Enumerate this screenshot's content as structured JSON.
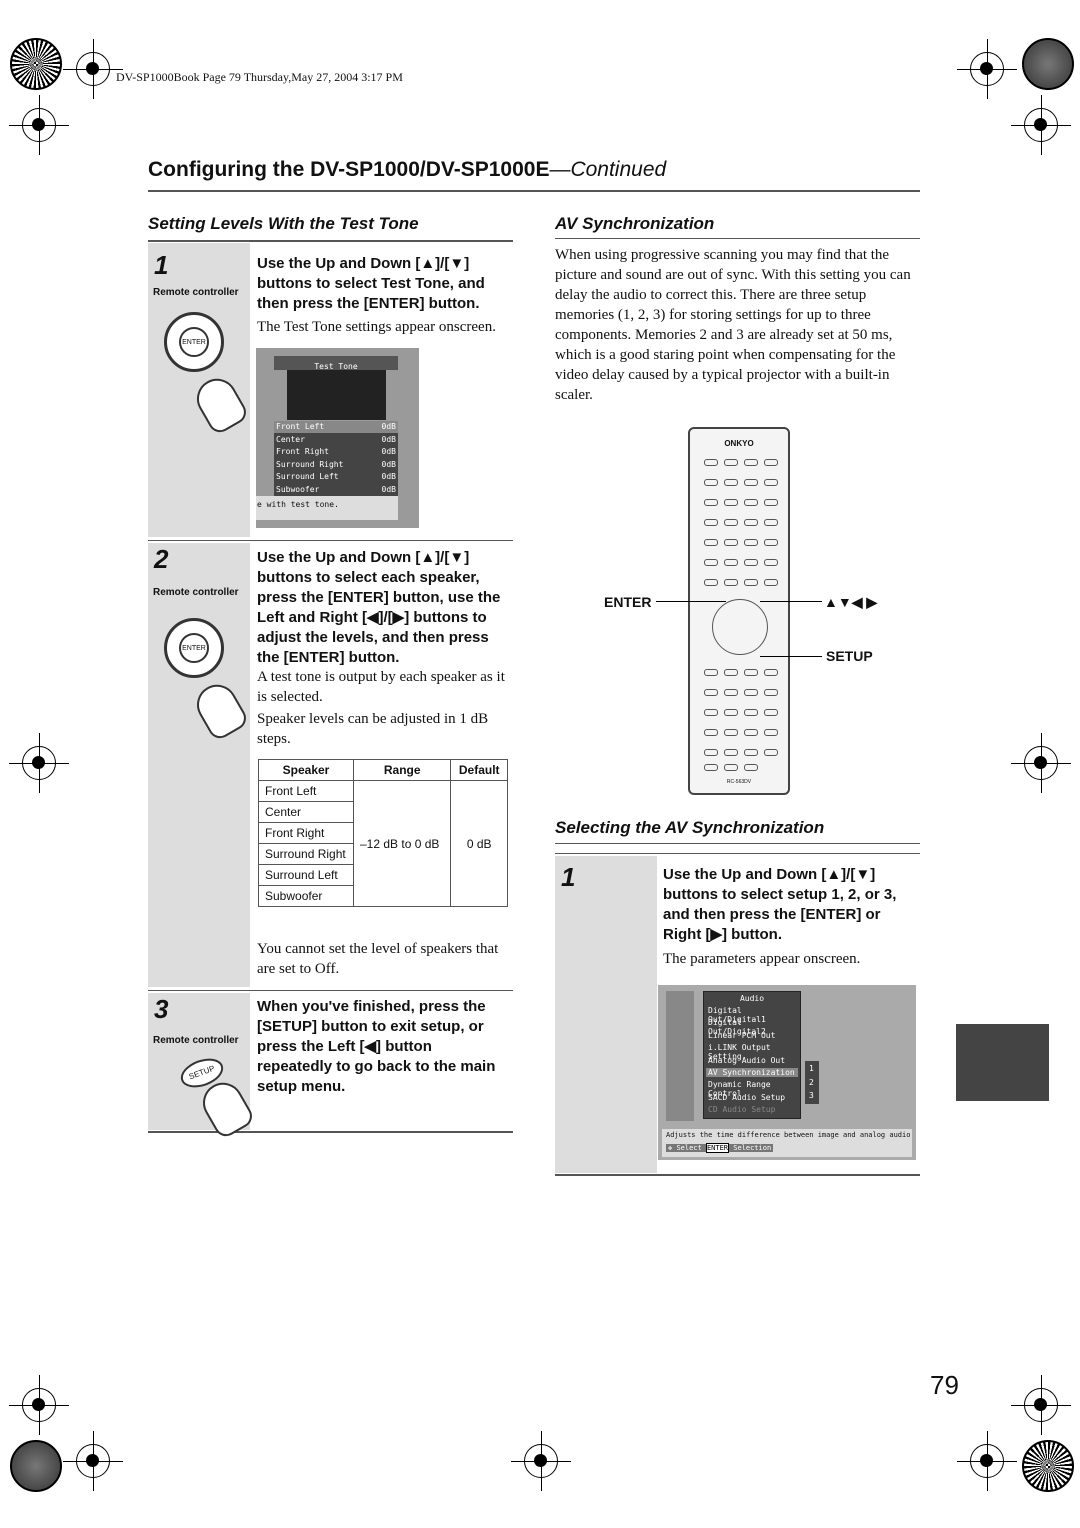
{
  "header": {
    "file_line": "DV-SP1000Book  Page 79  Thursday,May 27, 2004  3:17 PM"
  },
  "title": {
    "main": "Configuring the DV-SP1000/DV-SP1000E",
    "suffix": "—Continued"
  },
  "left": {
    "heading": "Setting Levels With the Test Tone",
    "remote_label": "Remote controller",
    "enter_label": "ENTER",
    "setup_label": "SETUP",
    "steps": [
      {
        "num": "1",
        "instruction": "Use the Up and Down [▲]/[▼] buttons to select Test Tone, and then press the [ENTER] button.",
        "body": [
          "The Test Tone settings appear onscreen."
        ]
      },
      {
        "num": "2",
        "instruction": "Use the Up and Down [▲]/[▼] buttons to select each speaker, press the [ENTER] button, use the Left and Right [◀]/[▶] buttons to adjust the levels, and then press the [ENTER] button.",
        "body": [
          "A test tone is output by each speaker as it is selected.",
          "Speaker levels can be adjusted in 1 dB steps."
        ],
        "note": "You cannot set the level of speakers that are set to Off."
      },
      {
        "num": "3",
        "instruction": "When you've finished, press the [SETUP] button to exit setup, or press the Left [◀] button repeatedly to go back to the main setup menu."
      }
    ],
    "osd": {
      "title": "Test Tone",
      "rows": [
        [
          "Front Left",
          "0dB"
        ],
        [
          "Center",
          "0dB"
        ],
        [
          "Front Right",
          "0dB"
        ],
        [
          "Surround Right",
          "0dB"
        ],
        [
          "Surround Left",
          "0dB"
        ],
        [
          "Subwoofer",
          "0dB"
        ]
      ],
      "footer": "e with test tone."
    },
    "table": {
      "headers": [
        "Speaker",
        "Range",
        "Default"
      ],
      "speakers": [
        "Front Left",
        "Center",
        "Front Right",
        "Surround Right",
        "Surround Left",
        "Subwoofer"
      ],
      "range": "–12 dB to 0 dB",
      "default": "0 dB"
    }
  },
  "right": {
    "heading": "AV Synchronization",
    "intro": "When using progressive scanning you may find that the picture and sound are out of sync. With this setting you can delay the audio to correct this. There are three setup memories (1, 2, 3) for storing settings for up to three components. Memories 2 and 3 are already set at 50 ms, which is a good staring point when compensating for the video delay caused by a typical projector with a built-in scaler.",
    "remote": {
      "brand": "ONKYO",
      "model": "RC-563DV"
    },
    "callouts": {
      "enter": "ENTER",
      "arrows": "▲▼◀ ▶",
      "setup": "SETUP"
    },
    "heading2": "Selecting the AV Synchronization",
    "step": {
      "num": "1",
      "instruction": "Use the Up and Down [▲]/[▼] buttons to select setup 1, 2, or 3, and then press the [ENTER] or Right [▶] button.",
      "body": "The parameters appear onscreen."
    },
    "osd": {
      "title": "Audio",
      "items": [
        "Digital Out/Digital1",
        "Digital Out/Digital2",
        "Linear PCM Out",
        "i.LINK Output Setting",
        "Analog Audio Out",
        "AV Synchronization",
        "Dynamic Range Control",
        "SACD Audio Setup",
        "CD Audio Setup"
      ],
      "selected": "AV Synchronization",
      "memories": [
        "1",
        "2",
        "3"
      ],
      "help": "Adjusts the time difference between image and analog audio",
      "select": "Select",
      "enter": "ENTER",
      "selection": "Selection"
    }
  },
  "page_number": "79"
}
